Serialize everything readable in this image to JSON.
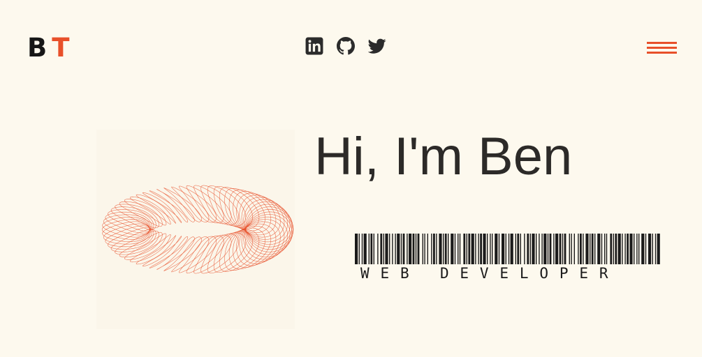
{
  "header": {
    "logo": {
      "first": "B",
      "second": "T"
    },
    "social_icons": [
      "linkedin-icon",
      "github-icon",
      "twitter-icon"
    ],
    "menu_icon": "hamburger-menu-icon"
  },
  "hero": {
    "title": "Hi, I'm Ben",
    "barcode_text": "WEB DEVELOPER"
  },
  "colors": {
    "background": "#fdf9ee",
    "accent": "#e8502a",
    "text": "#2c2a28"
  }
}
